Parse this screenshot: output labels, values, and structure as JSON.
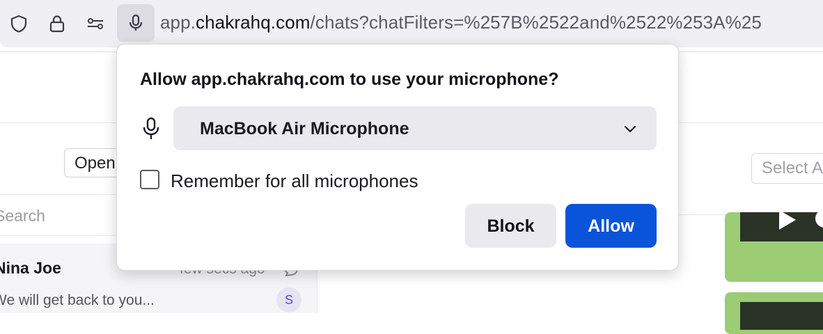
{
  "browser": {
    "url_prefix": "app.",
    "url_domain": "chakrahq.com",
    "url_path": "/chats?chatFilters=%257B%2522and%2522%253A%25",
    "icons": [
      "shield-icon",
      "lock-icon",
      "permissions-icon",
      "microphone-icon"
    ]
  },
  "app": {
    "status_filter": "Open",
    "search_placeholder": "Search",
    "chat": {
      "name": "Nina Joe",
      "time": "few secs ago",
      "snippet": "We will get back to you...",
      "avatar_initial": "S"
    },
    "right_filter_placeholder": "Select A"
  },
  "popup": {
    "title": "Allow app.chakrahq.com to use your microphone?",
    "device": "MacBook Air Microphone",
    "remember_label": "Remember for all microphones",
    "remember_checked": false,
    "block_label": "Block",
    "allow_label": "Allow",
    "accent_color": "#0a54d9"
  }
}
